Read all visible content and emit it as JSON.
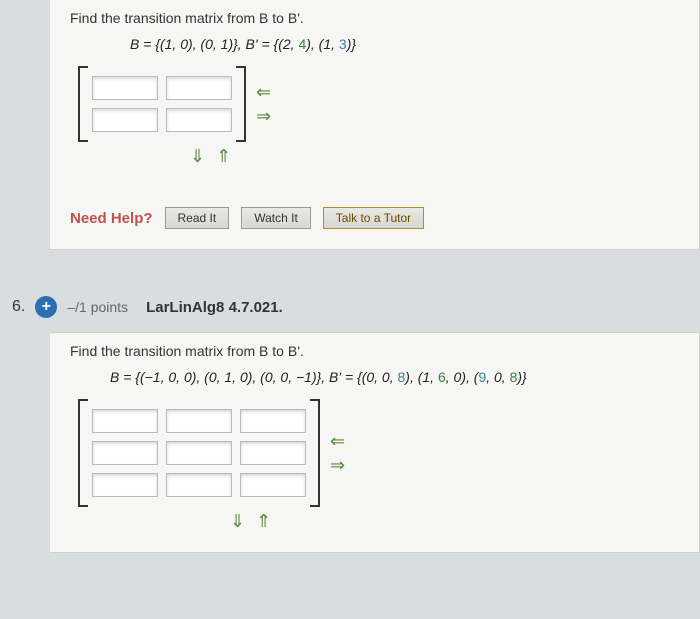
{
  "q5": {
    "prompt": "Find the transition matrix from B to B'.",
    "formula_prefix": "B = {(1, 0), (0, 1)}, B' = {(2, ",
    "formula_a": "4",
    "formula_mid": "), (1, ",
    "formula_b": "3",
    "formula_suffix": ")}",
    "help_label": "Need Help?",
    "btn_read": "Read It",
    "btn_watch": "Watch It",
    "btn_tutor": "Talk to a Tutor"
  },
  "q6": {
    "number": "6.",
    "points": "–/1 points",
    "chapter": "LarLinAlg8 4.7.021.",
    "prompt": "Find the transition matrix from B to B'.",
    "formula_prefix": "B = {(−1, 0, 0), (0, 1, 0), (0, 0, −1)}, B' = {(0, 0, ",
    "formula_a": "8",
    "formula_mid1": "), (1, ",
    "formula_b": "6",
    "formula_mid2": ", 0), (",
    "formula_c": "9",
    "formula_mid3": ", 0, ",
    "formula_d": "8",
    "formula_suffix": ")}"
  },
  "arrows": {
    "left": "⇐",
    "right": "⇒",
    "down": "⇓",
    "up": "⇑"
  }
}
